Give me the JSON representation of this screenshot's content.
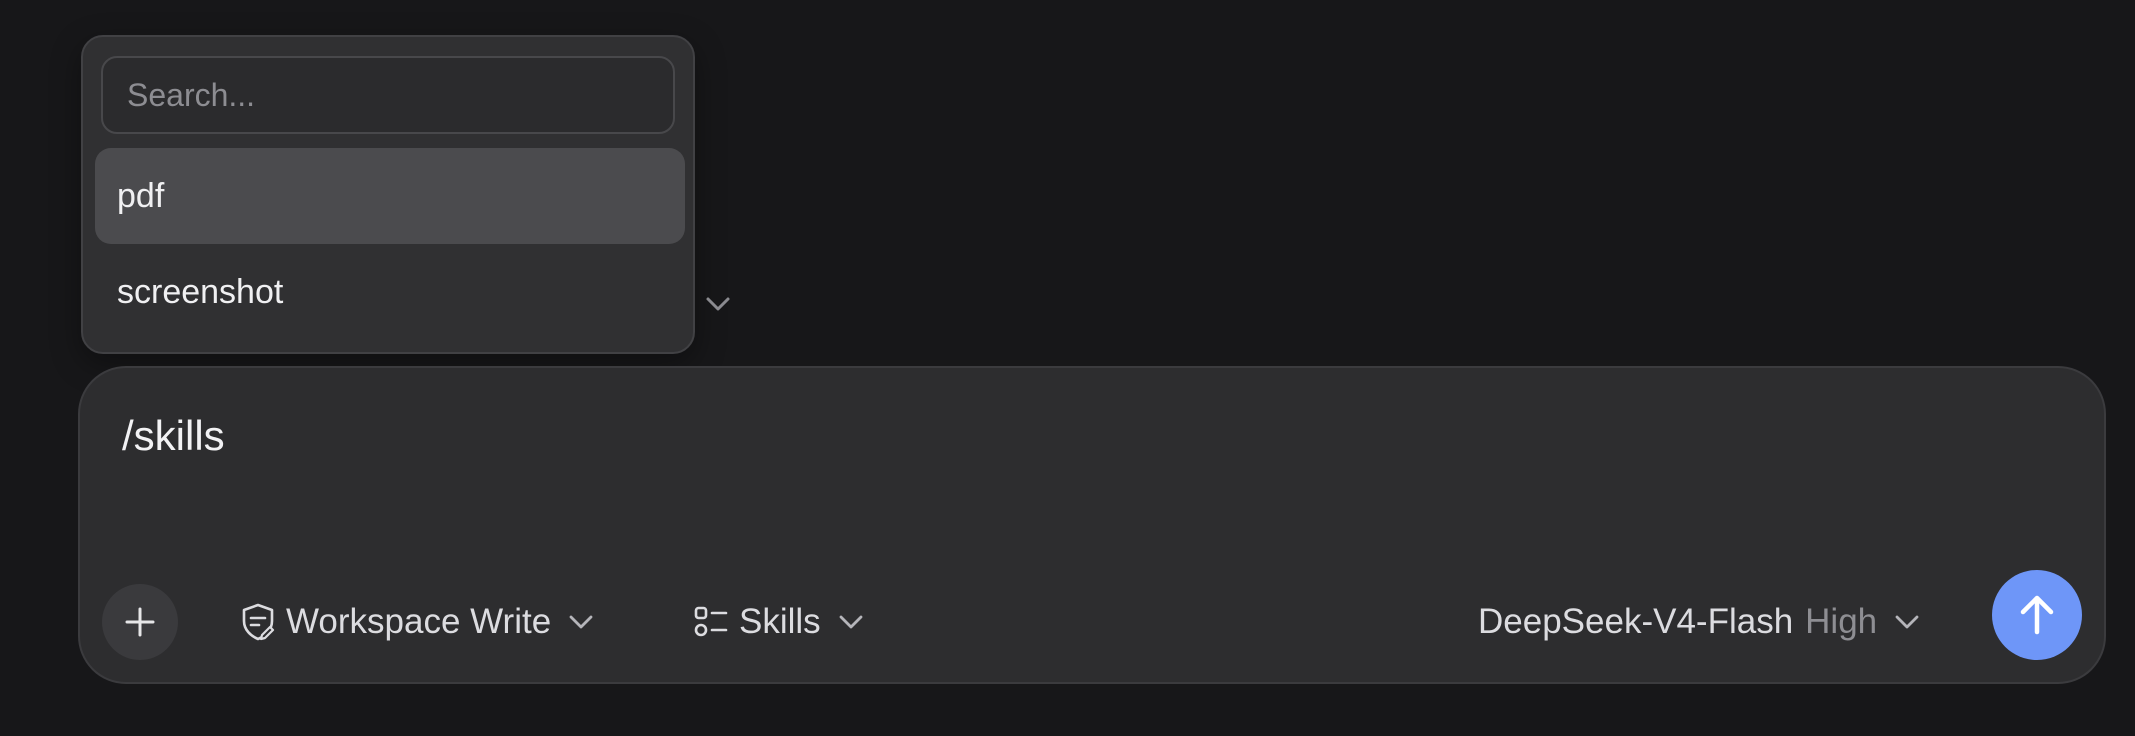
{
  "popover": {
    "search_placeholder": "Search...",
    "items": [
      {
        "label": "pdf",
        "active": true
      },
      {
        "label": "screenshot",
        "active": false
      }
    ]
  },
  "composer": {
    "input_text": "/skills",
    "permission_label": "Workspace Write",
    "skills_label": "Skills",
    "model_name": "DeepSeek-V4-Flash",
    "model_effort": "High"
  },
  "icons": {
    "add": "plus-icon",
    "permission": "shield-edit-icon",
    "skills": "list-icon",
    "send": "arrow-up-icon",
    "dropdown": "chevron-down-icon"
  },
  "colors": {
    "background": "#171719",
    "popover": "#303032",
    "active_item": "#4b4b4e",
    "composer": "#2d2d2f",
    "send_accent": "#6e96f8"
  }
}
